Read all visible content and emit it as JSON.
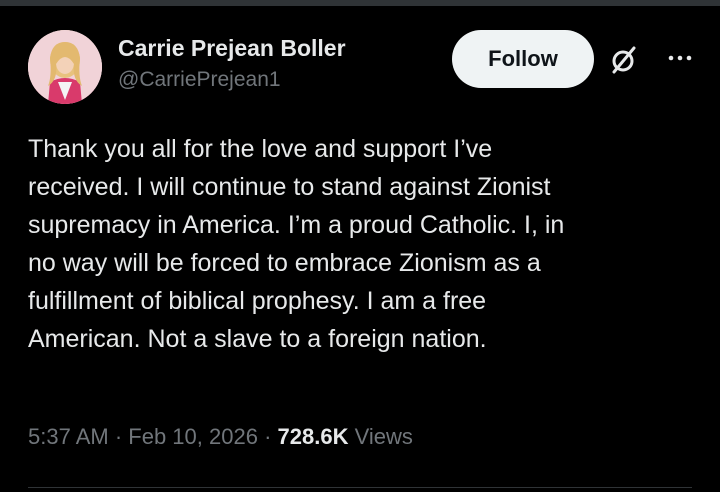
{
  "author": {
    "display_name": "Carrie Prejean Boller",
    "handle": "@CarriePrejean1"
  },
  "actions": {
    "follow_label": "Follow",
    "grok_icon": "grok-slash-icon",
    "more_icon": "more-dots-icon"
  },
  "tweet": {
    "text": "Thank you all for the love and support I’ve\nreceived. I will continue to stand against Zionist\nsupremacy in America. I’m a proud Catholic. I, in\nno way will be forced to embrace Zionism as a\nfulfillment of biblical prophesy. I am a free\nAmerican. Not a slave to a foreign nation."
  },
  "meta": {
    "time": "5:37 AM",
    "separator": " · ",
    "date": "Feb 10, 2026",
    "views_count": "728.6K",
    "views_label": " Views"
  },
  "colors": {
    "background": "#000000",
    "text_primary": "#e7e9ea",
    "text_secondary": "#71767b",
    "follow_bg": "#eff3f4",
    "border": "#2f3336"
  }
}
